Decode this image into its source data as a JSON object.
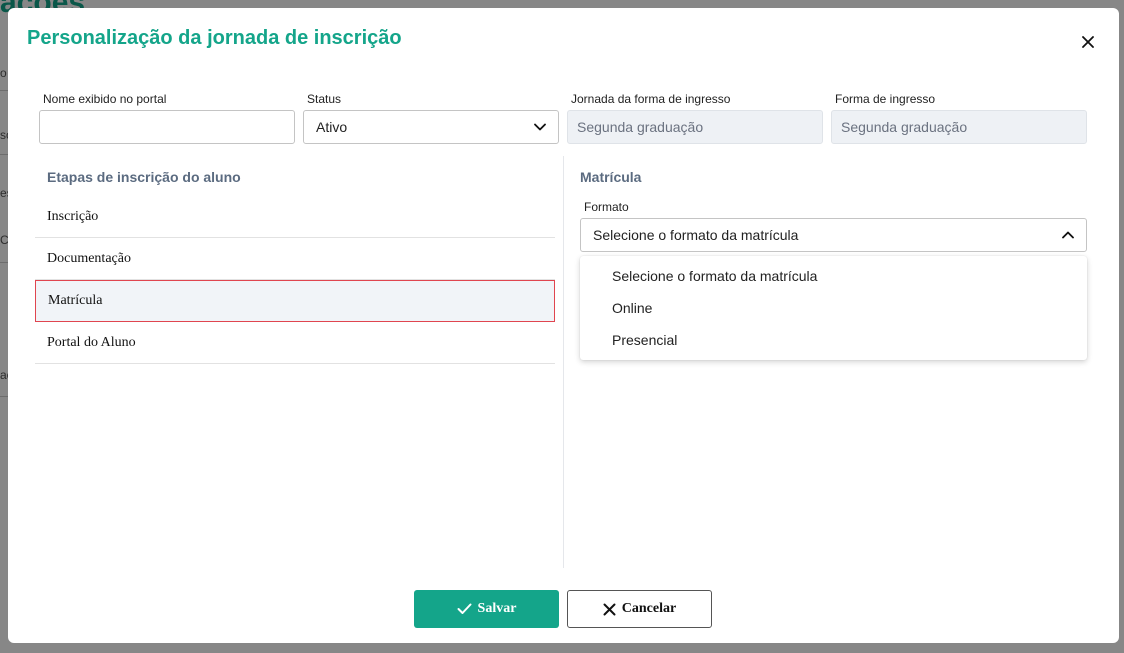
{
  "background": {
    "page_title_fragment": "ações",
    "fragments": [
      "o S",
      "so",
      "es",
      "CI",
      "aç"
    ]
  },
  "modal": {
    "title": "Personalização da jornada de inscrição",
    "close_icon": "close-icon"
  },
  "fields": {
    "nome": {
      "label": "Nome exibido no portal",
      "value": "",
      "placeholder": ""
    },
    "status": {
      "label": "Status",
      "value": "Ativo",
      "icon": "chevron-down-icon"
    },
    "jornada": {
      "label": "Jornada da forma de ingresso",
      "value": "Segunda graduação"
    },
    "forma": {
      "label": "Forma de ingresso",
      "value": "Segunda graduação"
    }
  },
  "steps_section": {
    "title": "Etapas de inscrição do aluno",
    "items": [
      {
        "label": "Inscrição",
        "active": false
      },
      {
        "label": "Documentação",
        "active": false
      },
      {
        "label": "Matrícula",
        "active": true
      },
      {
        "label": "Portal do Aluno",
        "active": false
      }
    ]
  },
  "detail_section": {
    "title": "Matrícula",
    "formato": {
      "label": "Formato",
      "value": "Selecione o formato da matrícula",
      "icon": "chevron-up-icon",
      "options": [
        "Selecione o formato da matrícula",
        "Online",
        "Presencial"
      ]
    }
  },
  "footer": {
    "save_label": "Salvar",
    "save_icon": "check-icon",
    "cancel_label": "Cancelar",
    "cancel_icon": "x-icon"
  },
  "colors": {
    "accent": "#14a58a",
    "active_border": "#e0454f",
    "section_title": "#5b6b80",
    "readonly_bg": "#eef1f5"
  }
}
